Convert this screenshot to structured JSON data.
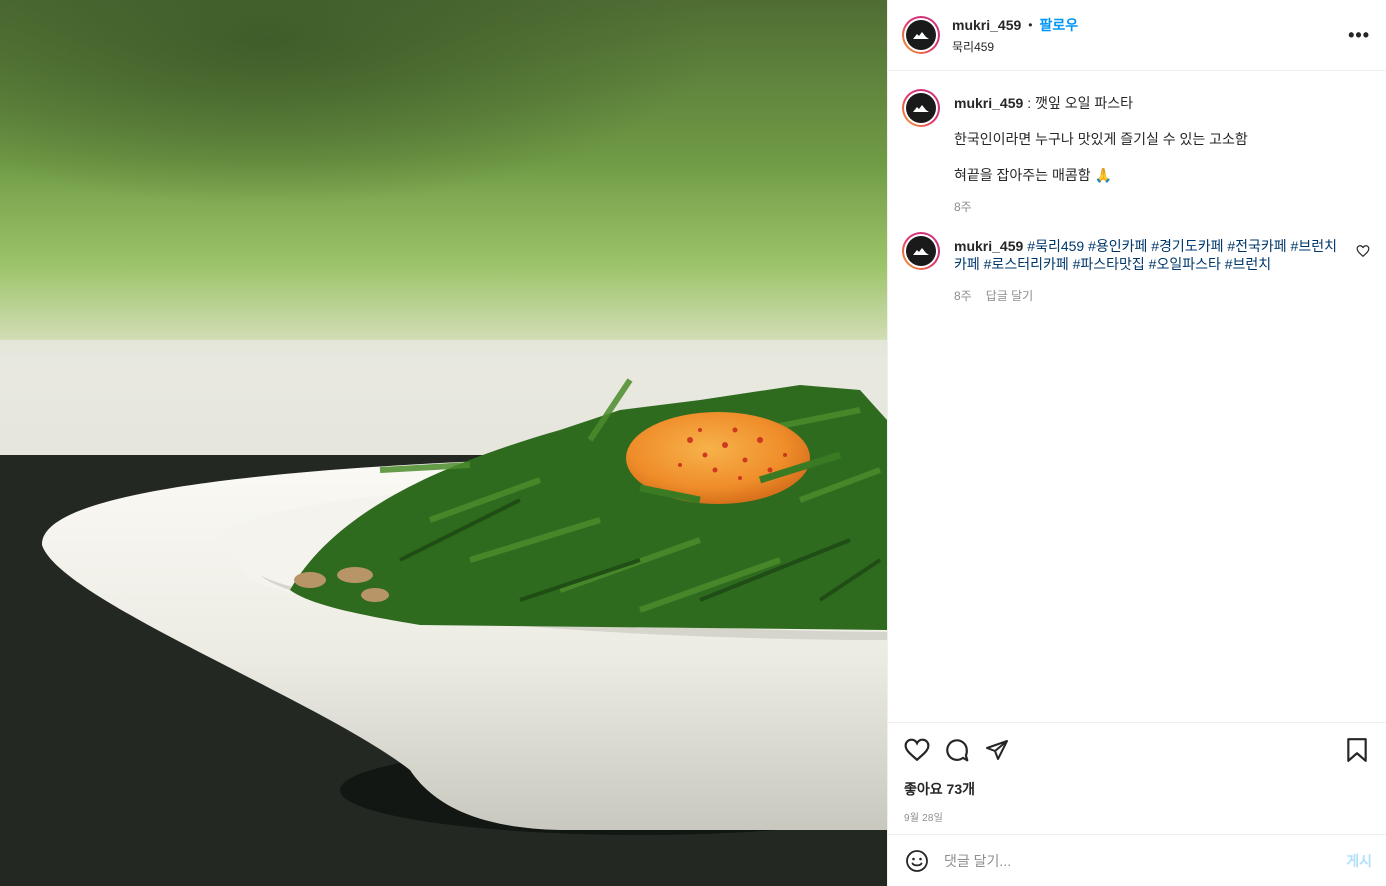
{
  "photo": {
    "alt_icon": "food-photo",
    "colors": {
      "bowl": "#efeee8",
      "leaf": "#2f6b1f",
      "yolk": "#f2a23a",
      "table": "#1f2420",
      "bg_green": "#8fbf5a"
    }
  },
  "header": {
    "username": "mukri_459",
    "dot": "•",
    "follow_label": "팔로우",
    "location": "묵리459",
    "more_icon": "more-options-icon"
  },
  "caption": {
    "username": "mukri_459",
    "title": ": 깻잎 오일 파스타",
    "line1": "한국인이라면 누구나 맛있게 즐기실 수 있는 고소함",
    "line2": "혀끝을 잡아주는 매콤함 🙏",
    "time": "8주"
  },
  "comment": {
    "username": "mukri_459",
    "text": "#묵리459 #용인카페 #경기도카페 #전국카페 #브런치카페 #로스터리카페 #파스타맛집 #오일파스타 #브런치",
    "time": "8주",
    "reply_label": "답글 달기"
  },
  "actions": {
    "likes_label": "좋아요 73개",
    "date": "9월 28일"
  },
  "compose": {
    "placeholder": "댓글 달기...",
    "post_label": "게시"
  },
  "colors": {
    "link": "#0095f6",
    "hashtag": "#00376b",
    "muted": "#8e8e8e",
    "post_disabled": "#b2dffc"
  }
}
